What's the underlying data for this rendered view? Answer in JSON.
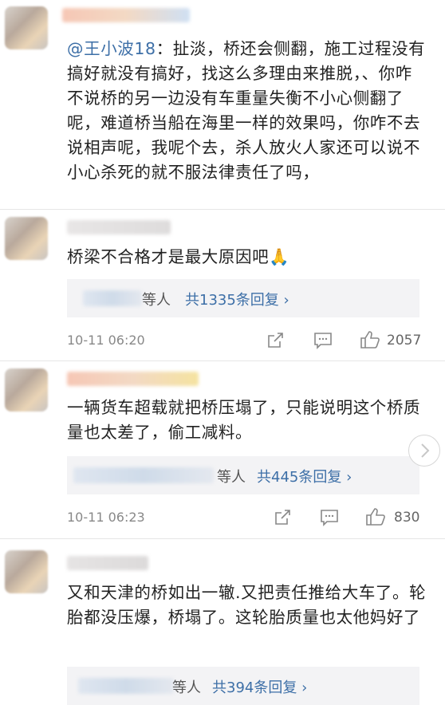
{
  "comments": [
    {
      "mention": "@王小波18",
      "text": "：扯淡，桥还会侧翻，施工过程没有搞好就没有搞好，找这么多理由来推脱，、你咋不说桥的另一边没有车重量失衡不小心侧翻了呢，难道桥当船在海里一样的效果吗，你咋不去说相声呢，我呢个去，杀人放火人家还可以说不小心杀死的就不服法律责任了吗，"
    },
    {
      "text": "桥梁不合格才是最大原因吧🙏",
      "reply_suffix": "等人",
      "reply_count": "共1335条回复 ›",
      "time": "10-11 06:20",
      "likes": "2057"
    },
    {
      "text": "一辆货车超载就把桥压塌了，只能说明这个桥质量也太差了，偷工减料。",
      "reply_suffix": "等人",
      "reply_count": "共445条回复 ›",
      "time": "10-11 06:23",
      "likes": "830"
    },
    {
      "text": "又和天津的桥如出一辙.又把责任推给大车了。轮胎都没压爆，桥塌了。这轮胎质量也太他妈好了",
      "reply_suffix": "等人",
      "reply_count": "共394条回复 ›"
    }
  ],
  "colors": {
    "link": "#3d6fa7",
    "muted": "#888888",
    "reply_bg": "#f3f3f5"
  },
  "icons": [
    "share-icon",
    "comment-icon",
    "like-icon",
    "chevron-right-icon"
  ]
}
